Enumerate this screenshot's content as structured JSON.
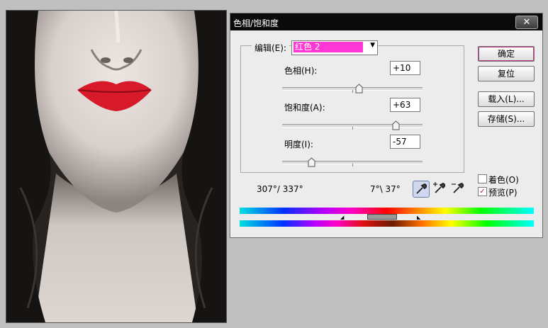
{
  "dialog": {
    "title": "色相/饱和度",
    "close_label": "✕",
    "edit_label": "编辑(E):",
    "edit_value": "红色 2",
    "hue": {
      "label": "色相(H):",
      "value": "+10",
      "level": 0.55
    },
    "saturation": {
      "label": "饱和度(A):",
      "value": "+63",
      "level": 0.81
    },
    "lightness": {
      "label": "明度(I):",
      "value": "-57",
      "level": 0.21
    },
    "buttons": {
      "ok": "确定",
      "reset": "复位",
      "load": "载入(L)...",
      "save": "存储(S)..."
    },
    "colorize": {
      "label": "着色(O)",
      "checked": false
    },
    "preview": {
      "label": "预览(P)",
      "checked": true,
      "mark": "✓"
    },
    "range_left": "307°/ 337°",
    "range_right": "7°\\ 37°",
    "icons": [
      "eyedropper-icon",
      "eyedropper-plus-icon",
      "eyedropper-minus-icon"
    ],
    "colors": {
      "accent": "#ff37d4",
      "titlebar": "#0a0a0a"
    }
  }
}
